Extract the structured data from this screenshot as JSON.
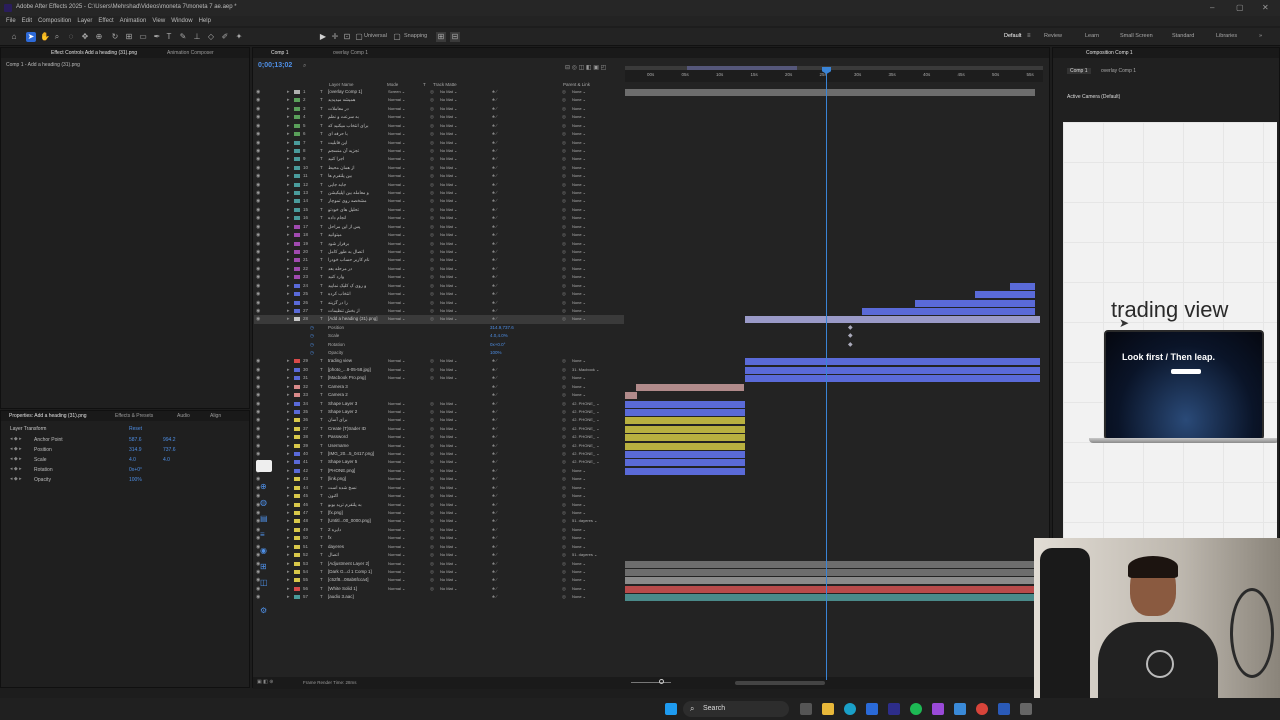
{
  "window": {
    "title": "Adobe After Effects 2025 - C:\\Users\\Mehrshad\\Videos\\moneta 7\\moneta 7 ae.aep *"
  },
  "menu": [
    "File",
    "Edit",
    "Composition",
    "Layer",
    "Effect",
    "Animation",
    "View",
    "Window",
    "Help"
  ],
  "toolbar": {
    "universal_label": "Universal",
    "snapping_label": "Snapping",
    "workspaces": [
      "Default",
      "Review",
      "Learn",
      "Small Screen",
      "Standard",
      "Libraries"
    ],
    "active_workspace": "Default"
  },
  "project_panel": {
    "tabs": [
      "Effect Controls Add a heading (31).png",
      "Animation Composer"
    ],
    "header": "Comp 1 - Add a heading (31).png"
  },
  "properties_panel": {
    "tabs": [
      "Properties: Add a heading (31).png",
      "Effects & Presets",
      "Audio",
      "Align"
    ],
    "section": "Layer Transform",
    "reset": "Reset",
    "props": [
      {
        "name": "Anchor Point",
        "v1": "587.6",
        "v2": "994.2"
      },
      {
        "name": "Position",
        "v1": "314.9",
        "v2": "737.6"
      },
      {
        "name": "Scale",
        "v1": "4.0",
        "v2": "4.0"
      },
      {
        "name": "Rotation",
        "v1": "0x+0°",
        "v2": ""
      },
      {
        "name": "Opacity",
        "v1": "100%",
        "v2": ""
      }
    ]
  },
  "timeline": {
    "tabs": [
      "Comp 1",
      "overlay Comp 1"
    ],
    "timecode": "0;00;13;02",
    "columns": [
      "Layer Name",
      "Mode",
      "T",
      "Track Matte",
      "Parent & Link"
    ],
    "ruler": [
      "00s",
      "05s",
      "10s",
      "15s",
      "20s",
      "25s",
      "30s",
      "35s",
      "40s",
      "45s",
      "50s",
      "55s"
    ],
    "expanded_props": [
      "Position",
      "Scale",
      "Rotation",
      "Opacity"
    ],
    "expanded_values": [
      "314.9,737.6",
      "4.0,4.0%",
      "0x+0.0°",
      "100%"
    ],
    "footer": "Frame Render Time: 28ms",
    "layers": [
      {
        "n": "1",
        "name": "[overlay Comp 1]",
        "mode": "Screen",
        "matte": "No Mat",
        "parent": "None",
        "color": "#b0b0b0"
      },
      {
        "n": "2",
        "name": "همیشه میدیدید",
        "mode": "Normal",
        "matte": "No Mat",
        "parent": "None",
        "color": "#5aa05a"
      },
      {
        "n": "3",
        "name": "در معاملات",
        "mode": "Normal",
        "matte": "No Mat",
        "parent": "None",
        "color": "#5aa05a"
      },
      {
        "n": "4",
        "name": "به سرعت و نظم",
        "mode": "Normal",
        "matte": "No Mat",
        "parent": "None",
        "color": "#5aa05a"
      },
      {
        "n": "5",
        "name": "برای انتخاب میکنید که",
        "mode": "Normal",
        "matte": "No Mat",
        "parent": "None",
        "color": "#5aa05a"
      },
      {
        "n": "6",
        "name": "با حرفه ای",
        "mode": "Normal",
        "matte": "No Mat",
        "parent": "None",
        "color": "#5aa05a"
      },
      {
        "n": "7",
        "name": "این قابلیت",
        "mode": "Normal",
        "matte": "No Mat",
        "parent": "None",
        "color": "#4a9c9c"
      },
      {
        "n": "8",
        "name": "تجزیه آن منسجم",
        "mode": "Normal",
        "matte": "No Mat",
        "parent": "None",
        "color": "#4a9c9c"
      },
      {
        "n": "9",
        "name": "اجرا کنید",
        "mode": "Normal",
        "matte": "No Mat",
        "parent": "None",
        "color": "#4a9c9c"
      },
      {
        "n": "10",
        "name": "از همان محیط",
        "mode": "Normal",
        "matte": "No Mat",
        "parent": "None",
        "color": "#4a9c9c"
      },
      {
        "n": "11",
        "name": "بین پلتفرم ها",
        "mode": "Normal",
        "matte": "No Mat",
        "parent": "None",
        "color": "#4a9c9c"
      },
      {
        "n": "12",
        "name": "جابه جایی",
        "mode": "Normal",
        "matte": "No Mat",
        "parent": "None",
        "color": "#4a9c9c"
      },
      {
        "n": "13",
        "name": "و معامله بین اپلیکیشن",
        "mode": "Normal",
        "matte": "No Mat",
        "parent": "None",
        "color": "#4a9c9c"
      },
      {
        "n": "14",
        "name": "مشخصه روی تموچار",
        "mode": "Normal",
        "matte": "No Mat",
        "parent": "None",
        "color": "#4a9c9c"
      },
      {
        "n": "15",
        "name": "تحلیل های خودتو",
        "mode": "Normal",
        "matte": "No Mat",
        "parent": "None",
        "color": "#4a9c9c"
      },
      {
        "n": "16",
        "name": "انجام داده",
        "mode": "Normal",
        "matte": "No Mat",
        "parent": "None",
        "color": "#4a9c9c"
      },
      {
        "n": "17",
        "name": "پس از این مراحل",
        "mode": "Normal",
        "matte": "No Mat",
        "parent": "None",
        "color": "#a04ab0"
      },
      {
        "n": "18",
        "name": "میتوانید",
        "mode": "Normal",
        "matte": "No Mat",
        "parent": "None",
        "color": "#a04ab0"
      },
      {
        "n": "19",
        "name": "برقرار شود",
        "mode": "Normal",
        "matte": "No Mat",
        "parent": "None",
        "color": "#a04ab0"
      },
      {
        "n": "20",
        "name": "اتصال به طور کامل",
        "mode": "Normal",
        "matte": "No Mat",
        "parent": "None",
        "color": "#a04ab0"
      },
      {
        "n": "21",
        "name": "نام کاربر حساب خودرا",
        "mode": "Normal",
        "matte": "No Mat",
        "parent": "None",
        "color": "#a04ab0"
      },
      {
        "n": "22",
        "name": "در مرحله بعد",
        "mode": "Normal",
        "matte": "No Mat",
        "parent": "None",
        "color": "#a04ab0"
      },
      {
        "n": "23",
        "name": "وارد کنید",
        "mode": "Normal",
        "matte": "No Mat",
        "parent": "None",
        "color": "#a04ab0"
      },
      {
        "n": "24",
        "name": "و روی ک کلیک نمایید",
        "mode": "Normal",
        "matte": "No Mat",
        "parent": "None",
        "color": "#5a6ad8"
      },
      {
        "n": "25",
        "name": "انتخاب کرده",
        "mode": "Normal",
        "matte": "No Mat",
        "parent": "None",
        "color": "#5a6ad8"
      },
      {
        "n": "26",
        "name": "را در گزینه",
        "mode": "Normal",
        "matte": "No Mat",
        "parent": "None",
        "color": "#5a6ad8"
      },
      {
        "n": "27",
        "name": "از بخش تنظیمات",
        "mode": "Normal",
        "matte": "No Mat",
        "parent": "None",
        "color": "#5a6ad8"
      },
      {
        "n": "28",
        "name": "[Add a heading (31).png]",
        "mode": "Normal",
        "matte": "No Mat",
        "parent": "None",
        "color": "#c8c8c8",
        "selected": true
      },
      {
        "n": "29",
        "name": "trading view",
        "mode": "Normal",
        "matte": "No Mat",
        "parent": "None",
        "color": "#d84a4a"
      },
      {
        "n": "30",
        "name": "[photo_...8-05-58.jpg]",
        "mode": "Normal",
        "matte": "No Mat",
        "parent": "31. Macbook",
        "color": "#5a6ad8"
      },
      {
        "n": "31",
        "name": "[Macbook Pro.png]",
        "mode": "Normal",
        "matte": "No Mat",
        "parent": "None",
        "color": "#5a6ad8"
      },
      {
        "n": "32",
        "name": "Camera 3",
        "mode": "",
        "matte": "",
        "parent": "None",
        "color": "#d88a8a"
      },
      {
        "n": "33",
        "name": "Camera 2",
        "mode": "",
        "matte": "",
        "parent": "None",
        "color": "#d88a8a"
      },
      {
        "n": "34",
        "name": "Shape Layer 3",
        "mode": "Normal",
        "matte": "No Mat",
        "parent": "42. PHONE_",
        "color": "#5a6ad8"
      },
      {
        "n": "35",
        "name": "Shape Layer 2",
        "mode": "Normal",
        "matte": "No Mat",
        "parent": "42. PHONE_",
        "color": "#5a6ad8"
      },
      {
        "n": "36",
        "name": "برای آسان",
        "mode": "Normal",
        "matte": "No Mat",
        "parent": "42. PHONE_",
        "color": "#d8c84a"
      },
      {
        "n": "37",
        "name": "Create (T)trader ID",
        "mode": "Normal",
        "matte": "No Mat",
        "parent": "42. PHONE_",
        "color": "#d8c84a"
      },
      {
        "n": "38",
        "name": "Password",
        "mode": "Normal",
        "matte": "No Mat",
        "parent": "42. PHONE_",
        "color": "#d8c84a"
      },
      {
        "n": "39",
        "name": "Username",
        "mode": "Normal",
        "matte": "No Mat",
        "parent": "42. PHONE_",
        "color": "#d8c84a"
      },
      {
        "n": "40",
        "name": "[IMG_20...5_0417.png]",
        "mode": "Normal",
        "matte": "No Mat",
        "parent": "42. PHONE_",
        "color": "#5a6ad8"
      },
      {
        "n": "41",
        "name": "Shape Layer 5",
        "mode": "Normal",
        "matte": "No Mat",
        "parent": "42. PHONE_",
        "color": "#5a6ad8"
      },
      {
        "n": "42",
        "name": "[PHONE.png]",
        "mode": "Normal",
        "matte": "No Mat",
        "parent": "None",
        "color": "#5a6ad8"
      },
      {
        "n": "43",
        "name": "[link.png]",
        "mode": "Normal",
        "matte": "No Mat",
        "parent": "None",
        "color": "#d8c84a"
      },
      {
        "n": "44",
        "name": "نسخ شده است",
        "mode": "Normal",
        "matte": "No Mat",
        "parent": "None",
        "color": "#d8c84a"
      },
      {
        "n": "45",
        "name": "اکنون",
        "mode": "Normal",
        "matte": "No Mat",
        "parent": "None",
        "color": "#d8c84a"
      },
      {
        "n": "46",
        "name": "به پلتفرم ترید بوبو",
        "mode": "Normal",
        "matte": "No Mat",
        "parent": "None",
        "color": "#d8c84a"
      },
      {
        "n": "47",
        "name": "[fx.png]",
        "mode": "Normal",
        "matte": "No Mat",
        "parent": "None",
        "color": "#d8c84a"
      },
      {
        "n": "48",
        "name": "[Untitl...00_0000.png]",
        "mode": "Normal",
        "matte": "No Mat",
        "parent": "51. dayeres",
        "color": "#d8c84a"
      },
      {
        "n": "49",
        "name": "دایره 2",
        "mode": "Normal",
        "matte": "No Mat",
        "parent": "None",
        "color": "#d8c84a"
      },
      {
        "n": "50",
        "name": "fx",
        "mode": "Normal",
        "matte": "No Mat",
        "parent": "None",
        "color": "#d8c84a"
      },
      {
        "n": "51",
        "name": "dayeres",
        "mode": "Normal",
        "matte": "No Mat",
        "parent": "None",
        "color": "#d8c84a"
      },
      {
        "n": "52",
        "name": "اتصال",
        "mode": "Normal",
        "matte": "No Mat",
        "parent": "51. dayeres",
        "color": "#d8c84a"
      },
      {
        "n": "53",
        "name": "[Adjustment Layer 2]",
        "mode": "Normal",
        "matte": "No Mat",
        "parent": "None",
        "color": "#d8c84a"
      },
      {
        "n": "54",
        "name": "[Dark G...d 1 Comp 1]",
        "mode": "Normal",
        "matte": "No Mat",
        "parent": "None",
        "color": "#d8c84a"
      },
      {
        "n": "55",
        "name": "[c52f8...08ab6fcca4]",
        "mode": "Normal",
        "matte": "No Mat",
        "parent": "None",
        "color": "#d8c84a"
      },
      {
        "n": "56",
        "name": "[White Solid 1]",
        "mode": "Normal",
        "matte": "No Mat",
        "parent": "None",
        "color": "#d84a4a"
      },
      {
        "n": "57",
        "name": "[audio 3.aac]",
        "mode": "",
        "matte": "",
        "parent": "None",
        "color": "#4a9c9c"
      }
    ]
  },
  "viewer": {
    "tabs": [
      "Composition Comp 1"
    ],
    "subtabs": [
      "Comp 1",
      "overlay Comp 1"
    ],
    "camera_label": "Active Camera (Default)",
    "heading_text": "trading view",
    "screen_text": "Look first / Then leap."
  },
  "taskbar": {
    "search_placeholder": "Search",
    "accent": "#0078d4"
  }
}
